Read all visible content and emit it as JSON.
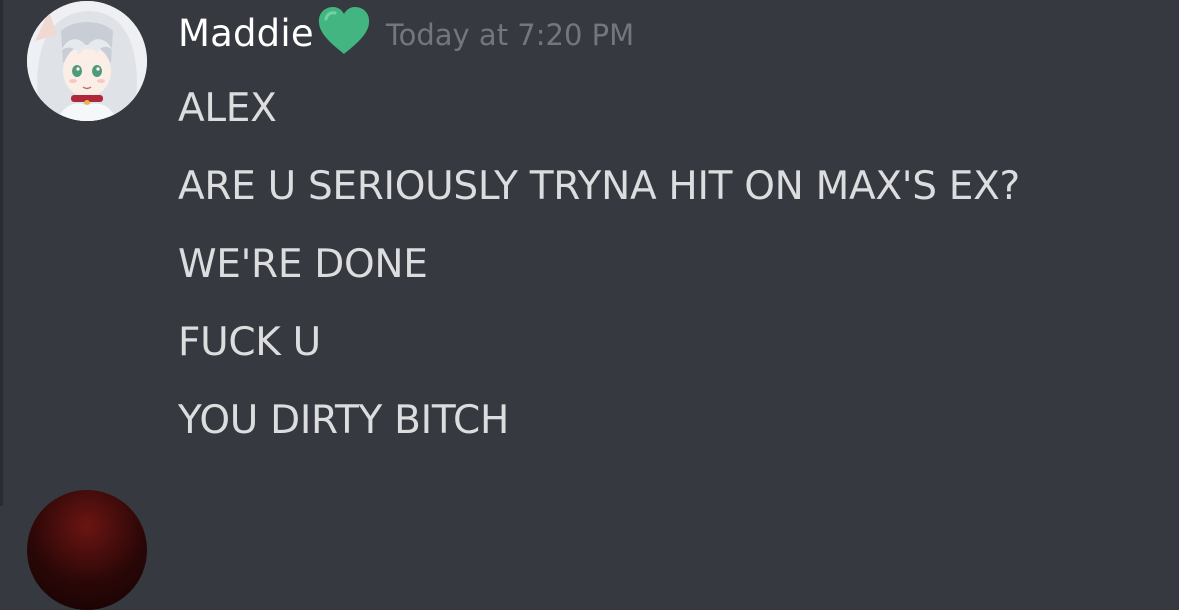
{
  "message": {
    "author": "Maddie",
    "author_badge_icon": "green-heart-icon",
    "timestamp": "Today at 7:20 PM",
    "lines": [
      "ALEX",
      "ARE U SERIOUSLY TRYNA HIT ON MAX'S EX?",
      "WE'RE DONE",
      "FUCK U",
      "YOU DIRTY BITCH"
    ]
  },
  "colors": {
    "background": "#36393f",
    "username": "#ffffff",
    "timestamp": "#72767d",
    "message_text": "#dcddde",
    "heart": "#43b581"
  }
}
